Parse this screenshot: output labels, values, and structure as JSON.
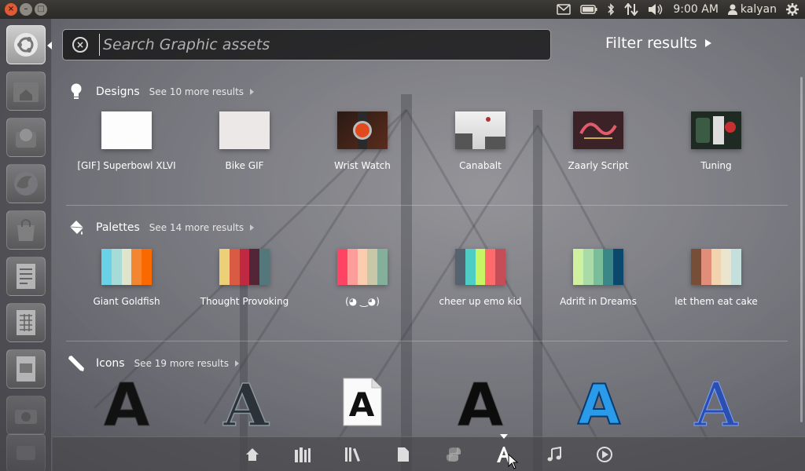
{
  "top_panel": {
    "clock": "9:00 AM",
    "username": "kalyan",
    "indicators": [
      "mail-icon",
      "battery-icon",
      "bluetooth-icon",
      "network-icon",
      "volume-icon",
      "clock",
      "user-icon",
      "session-gear-icon"
    ]
  },
  "search": {
    "placeholder": "Search Graphic assets",
    "value": ""
  },
  "filter": {
    "label": "Filter results"
  },
  "categories": [
    {
      "title": "Designs",
      "more": "See 10 more results",
      "items": [
        {
          "label": "[GIF] Superbowl XLVI"
        },
        {
          "label": "Bike GIF"
        },
        {
          "label": "Wrist Watch"
        },
        {
          "label": "Canabalt"
        },
        {
          "label": "Zaarly Script"
        },
        {
          "label": "Tuning"
        }
      ]
    },
    {
      "title": "Palettes",
      "more": "See 14 more results",
      "items": [
        {
          "label": "Giant Goldfish",
          "colors": [
            "#69d2e7",
            "#a7dbd8",
            "#e0e4cc",
            "#f38630",
            "#fa6900"
          ]
        },
        {
          "label": "Thought Provoking",
          "colors": [
            "#ecd078",
            "#d95b43",
            "#c02942",
            "#542437",
            "#53777a"
          ]
        },
        {
          "label": "(◕ ‿◕)",
          "colors": [
            "#fe4365",
            "#fc9d9a",
            "#f9cdad",
            "#c8c8a9",
            "#83af9b"
          ]
        },
        {
          "label": "cheer up emo kid",
          "colors": [
            "#556270",
            "#4ecdc4",
            "#c7f464",
            "#ff6b6b",
            "#c44d58"
          ]
        },
        {
          "label": "Adrift in Dreams",
          "colors": [
            "#cff09e",
            "#a8dba8",
            "#79bd9a",
            "#3b8686",
            "#0b486b"
          ]
        },
        {
          "label": "let them eat cake",
          "colors": [
            "#774f38",
            "#e08e79",
            "#f1d4af",
            "#ece5ce",
            "#c5e0dc"
          ]
        }
      ]
    },
    {
      "title": "Icons",
      "more": "See 19 more results",
      "items": [
        {
          "glyph": "A"
        },
        {
          "glyph": "A"
        },
        {
          "glyph": "A"
        },
        {
          "glyph": "A"
        },
        {
          "glyph": "A"
        },
        {
          "glyph": "A"
        }
      ]
    }
  ],
  "lenses": [
    "home-lens-icon",
    "applications-lens-icon",
    "library-lens-icon",
    "files-lens-icon",
    "python-lens-icon",
    "graphics-lens-icon",
    "music-lens-icon",
    "video-lens-icon"
  ]
}
